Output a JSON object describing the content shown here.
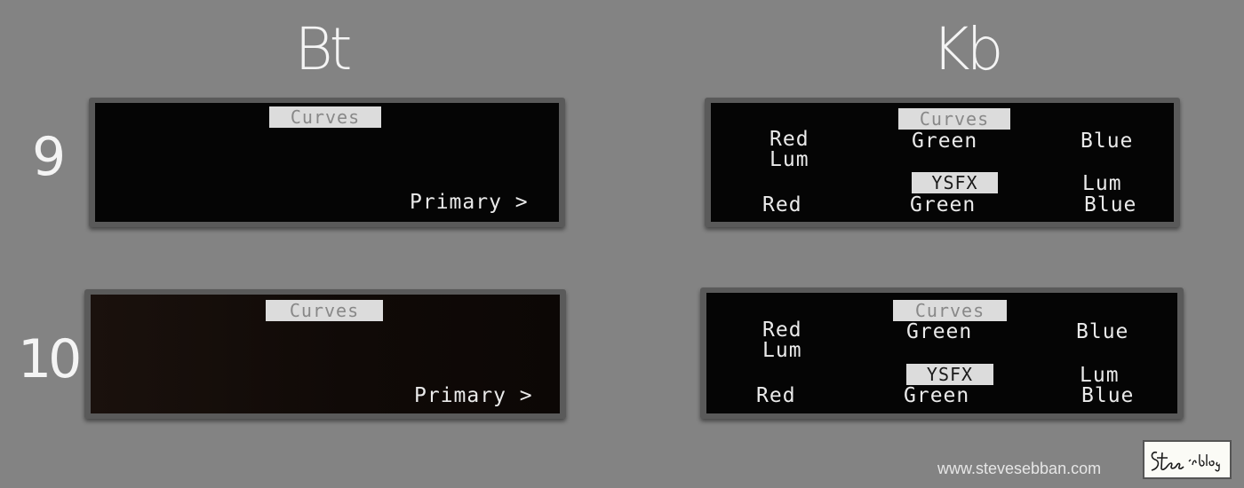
{
  "columns": {
    "left": "Bt",
    "right": "Kb"
  },
  "rows": {
    "first": "9",
    "second": "10"
  },
  "bt_panel": {
    "chip": "Curves",
    "nav": "Primary >"
  },
  "kb_panel": {
    "chip_top": "Curves",
    "chip_mid": "YSFX",
    "red": "Red",
    "lum": "Lum",
    "green": "Green",
    "blue": "Blue"
  },
  "footer": {
    "credit": "www.stevesebban.com",
    "logo_text": "Steve's Blog"
  }
}
